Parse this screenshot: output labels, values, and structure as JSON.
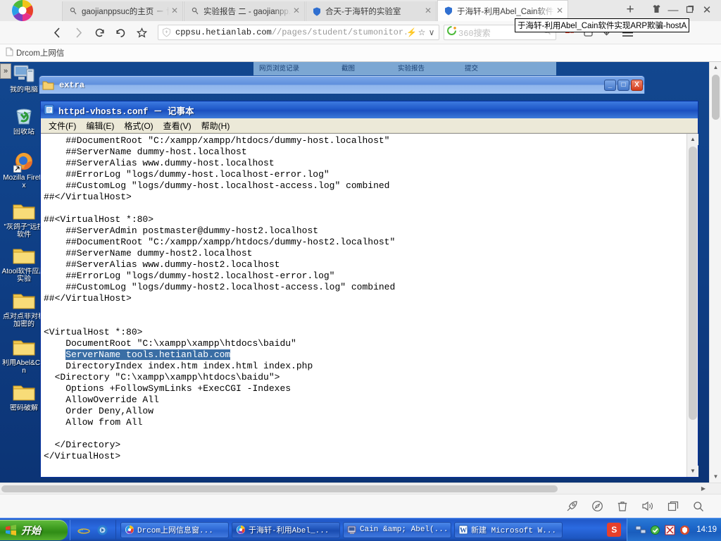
{
  "browser": {
    "tabs": [
      {
        "title": "gaojianppsuc的主页 － 博...",
        "favicon": "user-account-icon",
        "active": false
      },
      {
        "title": "实验报告 二 - gaojianpp...",
        "favicon": "user-account-icon",
        "active": false
      },
      {
        "title": "合天-于海轩的实验室",
        "favicon": "shield-icon",
        "active": false
      },
      {
        "title": "于海轩-利用Abel_Cain软件",
        "favicon": "shield-icon",
        "active": true
      }
    ],
    "new_tab_label": "+",
    "window_controls": {
      "shirt": "\u0001",
      "minimize": "—",
      "maximize": "❐",
      "close": "✕"
    },
    "nav": {
      "back": "‹",
      "forward": "›",
      "reload": "C",
      "home": "↺",
      "favorite": "☆"
    },
    "url": {
      "prefix": "cppsu.hetianlab.com",
      "path": "//pages/student/stumonitor.js",
      "lightning": "⚡",
      "star": "☆",
      "chevron": "∨"
    },
    "search_placeholder": "360搜索",
    "tooltip": "于海轩-利用Abel_Cain软件实现ARP欺骗-hostA",
    "bookmarks": [
      {
        "label": "Drcom上网信",
        "icon": "page-icon"
      }
    ],
    "bottom_icons": [
      "rocket-icon",
      "compass-icon",
      "trash-icon",
      "volume-icon",
      "window-icon",
      "search-icon"
    ]
  },
  "desktop": {
    "expand_chevron": "»",
    "icons": [
      {
        "label": "我的电脑",
        "icon": "my-computer-icon"
      },
      {
        "label": "回收站",
        "icon": "recycle-bin-icon"
      },
      {
        "label": "Mozilla Firefox",
        "icon": "firefox-icon"
      },
      {
        "label": "\"灰鸽子\"远控软件",
        "icon": "folder-icon"
      },
      {
        "label": "Atool软件应用实验",
        "icon": "folder-icon"
      },
      {
        "label": "点对点非对称加密的",
        "icon": "folder-icon"
      },
      {
        "label": "利用Abel&Cain",
        "icon": "folder-icon"
      },
      {
        "label": "密码破解",
        "icon": "folder-icon"
      }
    ],
    "lab_bar_labels": [
      "网页浏览记录",
      "截图",
      "实验报告",
      "提交"
    ]
  },
  "extra_window": {
    "title": "extra",
    "icon": "folder-icon",
    "buttons": {
      "minimize": "_",
      "maximize": "□",
      "close": "X"
    }
  },
  "notepad": {
    "title": "httpd-vhosts.conf － 记事本",
    "icon": "notepad-icon",
    "menu": [
      "文件(F)",
      "编辑(E)",
      "格式(O)",
      "查看(V)",
      "帮助(H)"
    ],
    "content_before": "    ##DocumentRoot \"C:/xampp/xampp/htdocs/dummy-host.localhost\"\n    ##ServerName dummy-host.localhost\n    ##ServerAlias www.dummy-host.localhost\n    ##ErrorLog \"logs/dummy-host.localhost-error.log\"\n    ##CustomLog \"logs/dummy-host.localhost-access.log\" combined\n##</VirtualHost>\n\n##<VirtualHost *:80>\n    ##ServerAdmin postmaster@dummy-host2.localhost\n    ##DocumentRoot \"C:/xampp/xampp/htdocs/dummy-host2.localhost\"\n    ##ServerName dummy-host2.localhost\n    ##ServerAlias www.dummy-host2.localhost\n    ##ErrorLog \"logs/dummy-host2.localhost-error.log\"\n    ##CustomLog \"logs/dummy-host2.localhost-access.log\" combined\n##</VirtualHost>\n\n\n<VirtualHost *:80>\n    DocumentRoot \"C:\\xampp\\xampp\\htdocs\\baidu\"\n    ",
    "selected_text": "ServerName tools.hetianlab.com",
    "content_after": "\n    DirectoryIndex index.htm index.html index.php\n  <Directory \"C:\\xampp\\xampp\\htdocs\\baidu\">\n    Options +FollowSymLinks +ExecCGI -Indexes\n    AllowOverride All\n    Order Deny,Allow\n    Allow from All\n\n  </Directory>\n</VirtualHost>"
  },
  "taskbar": {
    "start_label": "开始",
    "quicklaunch": [
      "ie-icon",
      "media-icon"
    ],
    "tasks": [
      {
        "label": "Drcom上网信息窗...",
        "icon": "drcom-icon",
        "active": false
      },
      {
        "label": "于海轩-利用Abel_...",
        "icon": "browser-icon",
        "active": true
      },
      {
        "label": "Cain &amp; Abel(...",
        "icon": "cain-icon",
        "active": false
      },
      {
        "label": "新建 Microsoft W...",
        "icon": "word-icon",
        "active": false
      }
    ],
    "sogou_badge": "S",
    "tray_icons": [
      "network-icon",
      "shield-icon",
      "antivirus-icon",
      "security-icon"
    ],
    "clock": "14:19"
  }
}
